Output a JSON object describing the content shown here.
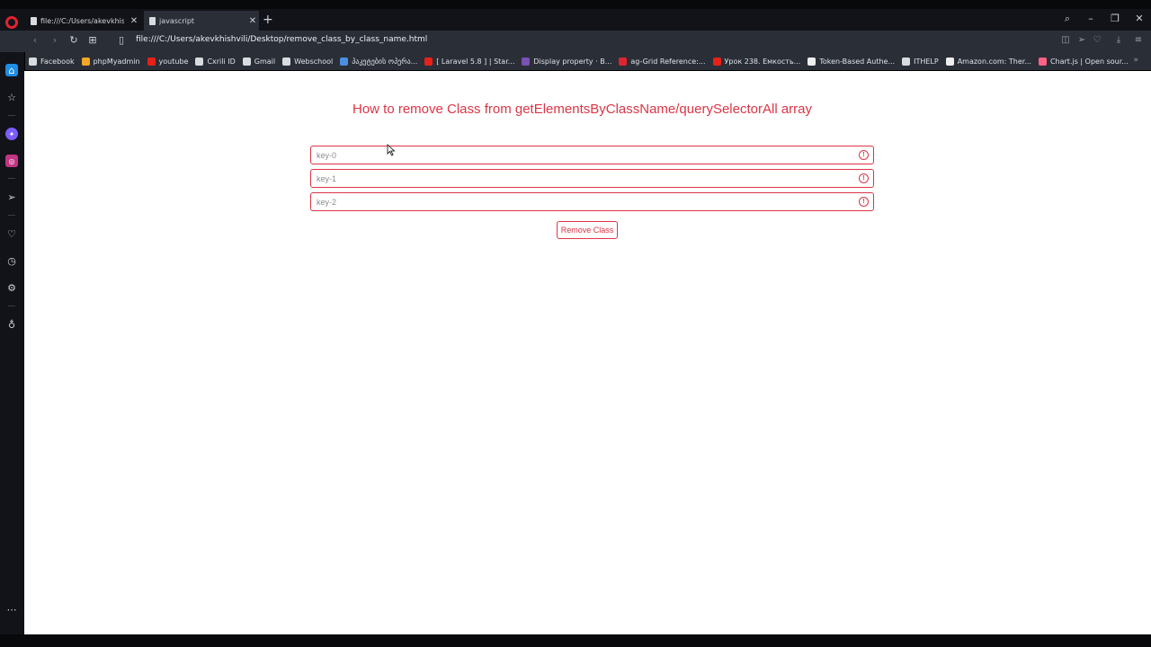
{
  "browser": {
    "tabs": [
      {
        "label": "file:///C:/Users/akevkhishvili"
      },
      {
        "label": "javascript"
      }
    ],
    "url": "file:///C:/Users/akevkhishvili/Desktop/remove_class_by_class_name.html",
    "bookmarks": [
      {
        "label": "Facebook",
        "icon": "doc-icon",
        "color": "#d8dbe0"
      },
      {
        "label": "phpMyadmin",
        "icon": "php-icon",
        "color": "#f5a623"
      },
      {
        "label": "youtube",
        "icon": "youtube-icon",
        "color": "#e62117"
      },
      {
        "label": "Cxrili ID",
        "icon": "doc-icon",
        "color": "#d8dbe0"
      },
      {
        "label": "Gmail",
        "icon": "doc-icon",
        "color": "#d8dbe0"
      },
      {
        "label": "Webschool",
        "icon": "w-icon",
        "color": "#d8dbe0"
      },
      {
        "label": "პაკეტების ოპერა...",
        "icon": "e-icon",
        "color": "#4a90e2"
      },
      {
        "label": "[ Laravel 5.8 ] | Star...",
        "icon": "youtube-icon",
        "color": "#e62117"
      },
      {
        "label": "Display property · B...",
        "icon": "bootstrap-icon",
        "color": "#7952b3"
      },
      {
        "label": "ag-Grid Reference:...",
        "icon": "ag-icon",
        "color": "#e0242f"
      },
      {
        "label": "Урок 238. Емкость...",
        "icon": "youtube-icon",
        "color": "#e62117"
      },
      {
        "label": "Token-Based Authe...",
        "icon": "dev-icon",
        "color": "#eeeeee"
      },
      {
        "label": "ITHELP",
        "icon": "doc-icon",
        "color": "#d8dbe0"
      },
      {
        "label": "Amazon.com: Ther...",
        "icon": "amazon-icon",
        "color": "#eeeeee"
      },
      {
        "label": "Chart.js | Open sour...",
        "icon": "chartjs-icon",
        "color": "#ff6384"
      }
    ]
  },
  "page": {
    "heading": "How to remove Class from getElementsByClassName/querySelectorAll array",
    "fields": [
      {
        "placeholder": "key-0"
      },
      {
        "placeholder": "key-1"
      },
      {
        "placeholder": "key-2"
      }
    ],
    "button_label": "Remove Class",
    "accent": "#dc3545"
  }
}
